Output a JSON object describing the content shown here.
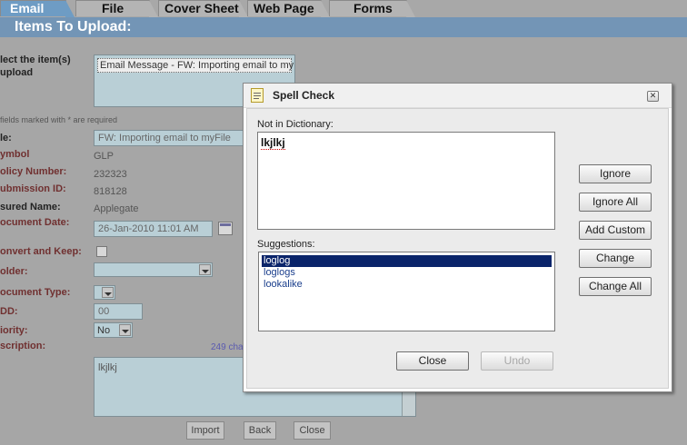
{
  "tabs": [
    {
      "label": "Email",
      "active": true
    },
    {
      "label": "File",
      "active": false
    },
    {
      "label": "Cover Sheet",
      "active": false
    },
    {
      "label": "Web Page",
      "active": false
    },
    {
      "label": "Forms",
      "active": false
    }
  ],
  "section_title": "Items To Upload:",
  "form": {
    "select_items_label_1": "lect the item(s)",
    "select_items_label_2": "upload",
    "items_list": [
      "Email Message - FW: Importing email to myFile"
    ],
    "required_note": "fields marked with * are required",
    "title_label": "le:",
    "title_value": "FW: Importing email to myFile",
    "symbol_label": "ymbol",
    "symbol_value": "GLP",
    "policy_label": "olicy Number:",
    "policy_value": "232323",
    "submission_label": "ubmission ID:",
    "submission_value": "818128",
    "insured_label": "sured Name:",
    "insured_value": "Applegate",
    "docdate_label": "ocument Date:",
    "docdate_value": "26-Jan-2010 11:01 AM",
    "convert_label": "onvert and Keep:",
    "folder_label": "older:",
    "doctype_label": "ocument Type:",
    "dd_label": "DD:",
    "dd_value": "00",
    "priority_label": "iority:",
    "priority_value": "No",
    "description_label": "scription:",
    "chars_left": "249 cha",
    "description_value": "lkjlkj"
  },
  "buttons": {
    "import": "Import",
    "back": "Back",
    "close": "Close"
  },
  "spell": {
    "title": "Spell Check",
    "not_in_dict_label": "Not in Dictionary:",
    "word": "lkjlkj",
    "suggestions_label": "Suggestions:",
    "suggestions": [
      "loglog",
      "loglogs",
      "lookalike"
    ],
    "ignore": "Ignore",
    "ignore_all": "Ignore All",
    "add_custom": "Add Custom",
    "change": "Change",
    "change_all": "Change All",
    "close": "Close",
    "undo": "Undo"
  },
  "colors": {
    "accent": "#6e9cc4",
    "header": "#7395b6",
    "label": "#703030",
    "selection": "#0a246a"
  }
}
